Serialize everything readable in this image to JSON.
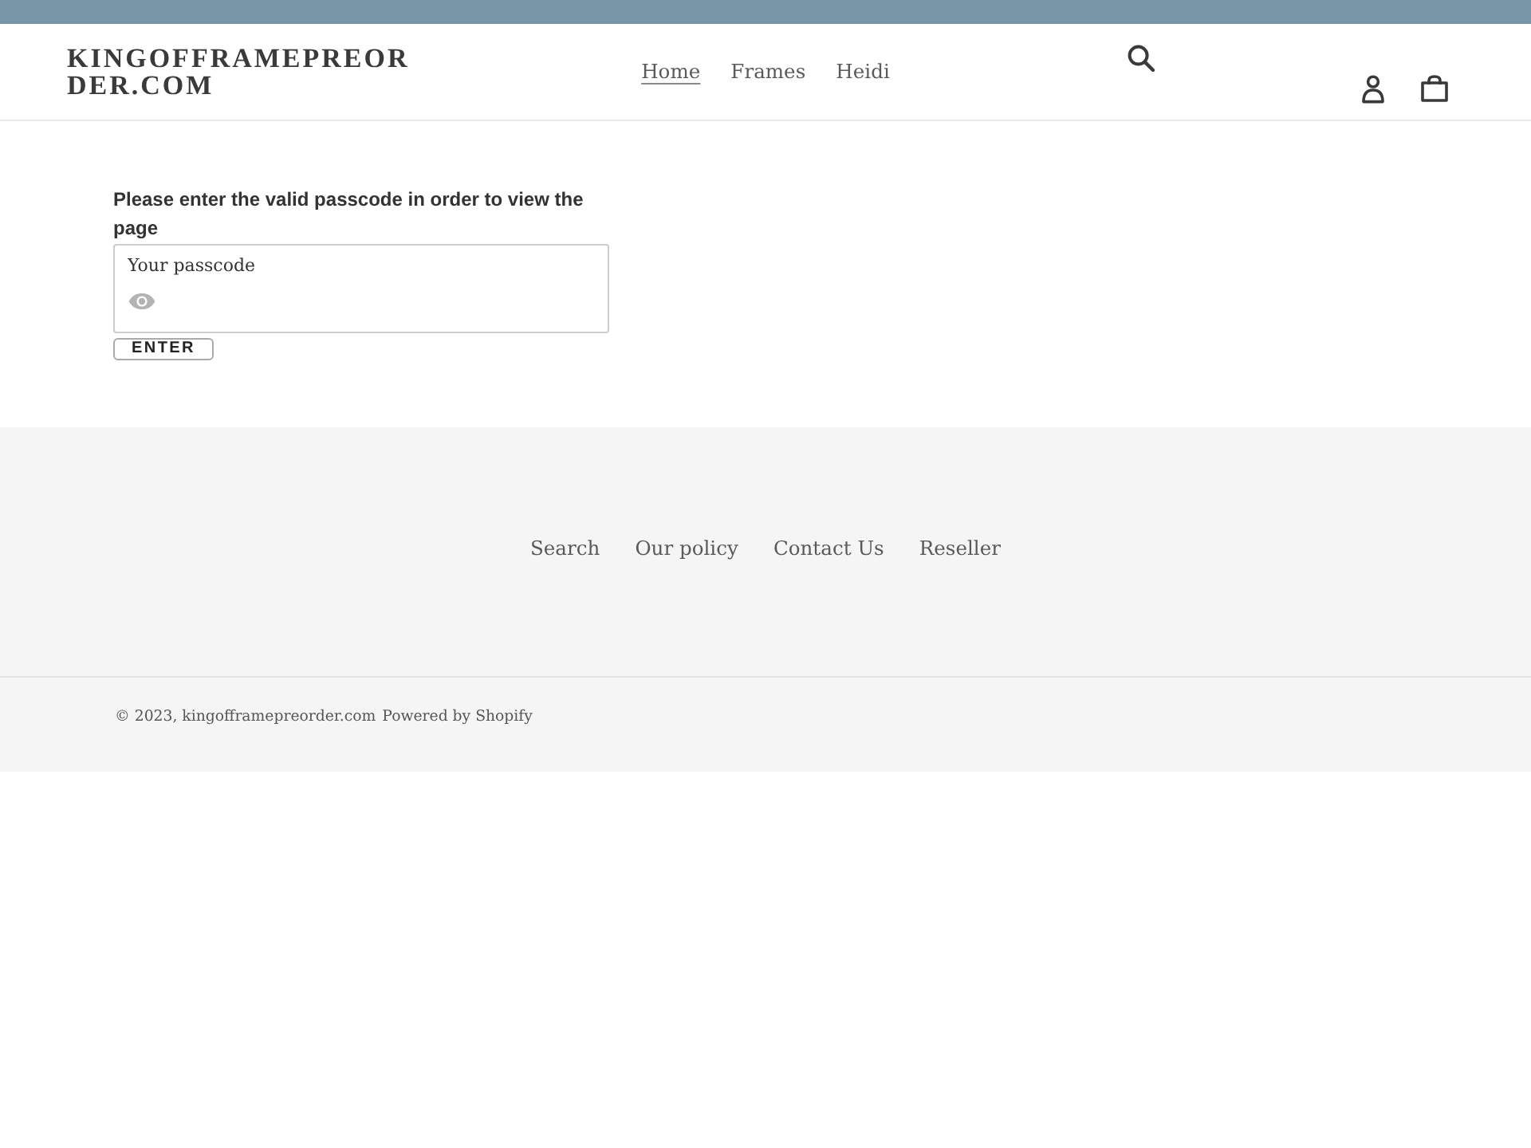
{
  "header": {
    "logo": "KINGOFFRAMEPREORDER.COM",
    "nav": [
      {
        "label": "Home",
        "selected": true
      },
      {
        "label": "Frames",
        "selected": false
      },
      {
        "label": "Heidi",
        "selected": false
      }
    ]
  },
  "passcode_form": {
    "prompt": "Please enter the valid passcode in order to view the page",
    "field": {
      "placeholder": "Your passcode"
    },
    "button": "ENTER"
  },
  "footer": {
    "links": [
      "Search",
      "Our policy",
      "Contact Us",
      "Reseller"
    ],
    "copyright": "© 2023, kingofframepreorder.com",
    "powered_by": "Powered by Shopify"
  }
}
